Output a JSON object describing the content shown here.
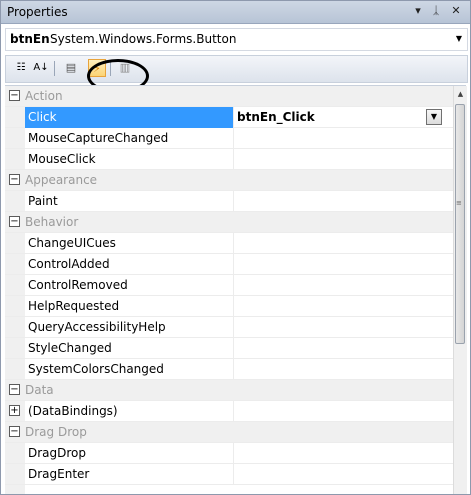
{
  "window": {
    "title": "Properties",
    "dropdown_glyph": "▾",
    "pin_glyph": "ᛣ",
    "close_glyph": "✕"
  },
  "object_selector": {
    "name": "btnEn",
    "type": "System.Windows.Forms.Button",
    "dropdown_glyph": "▼"
  },
  "toolbar": {
    "active_tool": "events",
    "buttons": [
      {
        "name": "categorized",
        "glyph": "☷"
      },
      {
        "name": "alphabetical",
        "glyph": "A↓"
      },
      {
        "name": "properties",
        "glyph": "▤"
      },
      {
        "name": "events",
        "glyph": "⚡"
      },
      {
        "name": "property-pages",
        "glyph": "▥"
      }
    ]
  },
  "grid": {
    "collapse_glyph": "−",
    "expand_glyph": "+",
    "combo_glyph": "▼",
    "rows": [
      {
        "type": "category",
        "label": "Action"
      },
      {
        "type": "item",
        "label": "Click",
        "value": "btnEn_Click",
        "selected": true
      },
      {
        "type": "item",
        "label": "MouseCaptureChanged",
        "value": ""
      },
      {
        "type": "item",
        "label": "MouseClick",
        "value": ""
      },
      {
        "type": "category",
        "label": "Appearance"
      },
      {
        "type": "item",
        "label": "Paint",
        "value": ""
      },
      {
        "type": "category",
        "label": "Behavior"
      },
      {
        "type": "item",
        "label": "ChangeUICues",
        "value": ""
      },
      {
        "type": "item",
        "label": "ControlAdded",
        "value": ""
      },
      {
        "type": "item",
        "label": "ControlRemoved",
        "value": ""
      },
      {
        "type": "item",
        "label": "HelpRequested",
        "value": ""
      },
      {
        "type": "item",
        "label": "QueryAccessibilityHelp",
        "value": ""
      },
      {
        "type": "item",
        "label": "StyleChanged",
        "value": ""
      },
      {
        "type": "item",
        "label": "SystemColorsChanged",
        "value": ""
      },
      {
        "type": "category",
        "label": "Data"
      },
      {
        "type": "item",
        "label": "(DataBindings)",
        "value": "",
        "expandable": true
      },
      {
        "type": "category",
        "label": "Drag Drop"
      },
      {
        "type": "item",
        "label": "DragDrop",
        "value": ""
      },
      {
        "type": "item",
        "label": "DragEnter",
        "value": ""
      }
    ]
  },
  "scrollbar": {
    "up_glyph": "▲",
    "grip_glyph": "≡"
  }
}
